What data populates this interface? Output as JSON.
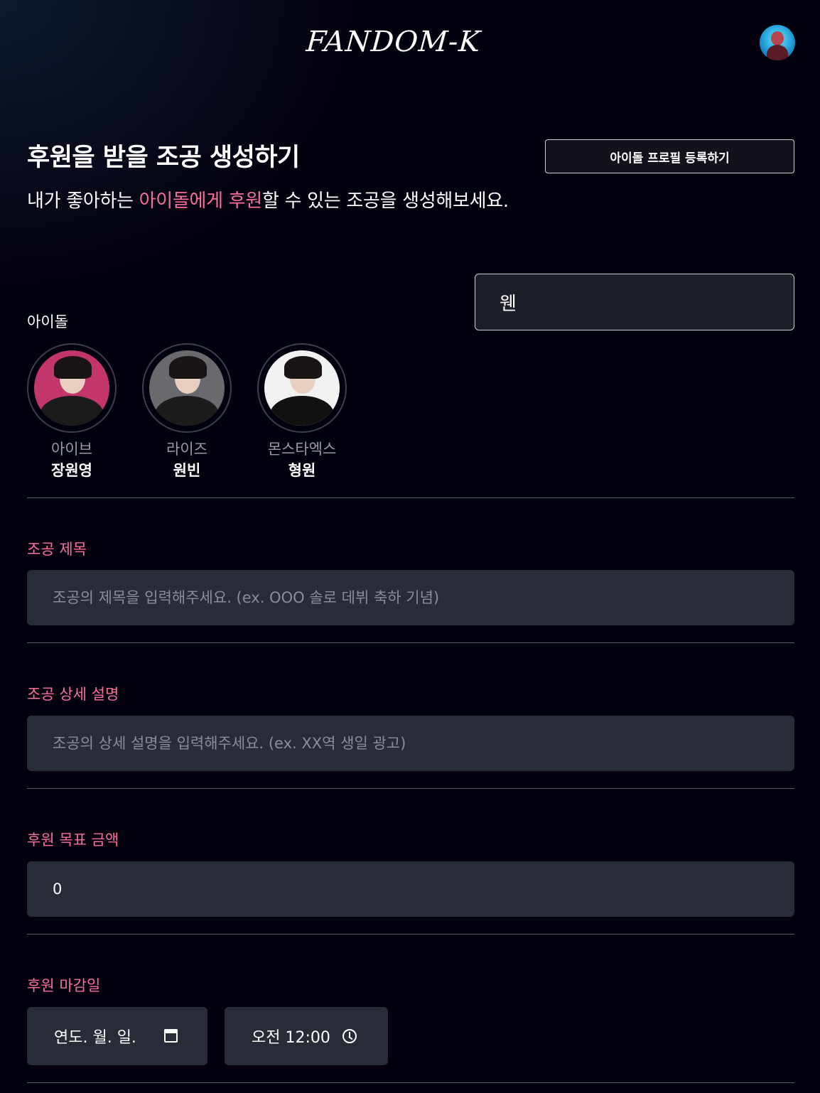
{
  "header": {
    "logo": "FANDOM-K",
    "avatar_icon": "user-avatar-icon"
  },
  "page": {
    "title": "후원을 받을 조공 생성하기",
    "register_button": "아이돌 프로필 등록하기",
    "subtitle": {
      "prefix": "내가 좋아하는 ",
      "highlight1": "아이돌에게",
      "middle": " ",
      "highlight2": "후원",
      "suffix": "할 수 있는 조공을 생성해보세요."
    }
  },
  "search": {
    "value": "웬"
  },
  "idols": {
    "label": "아이돌",
    "items": [
      {
        "group": "아이브",
        "name": "장원영",
        "bg": "#c2366b",
        "outfit": "#1b1b1b"
      },
      {
        "group": "라이즈",
        "name": "원빈",
        "bg": "#6a6a6e",
        "outfit": "#1c1c1c"
      },
      {
        "group": "몬스타엑스",
        "name": "형원",
        "bg": "#f2f2f2",
        "outfit": "#111111"
      }
    ]
  },
  "form": {
    "title_label": "조공 제목",
    "title_placeholder": "조공의 제목을 입력해주세요. (ex. OOO 솔로 데뷔 축하 기념)",
    "desc_label": "조공 상세 설명",
    "desc_placeholder": "조공의 상세 설명을 입력해주세요. (ex. XX역 생일 광고)",
    "amount_label": "후원 목표 금액",
    "amount_value": "0",
    "deadline_label": "후원 마감일",
    "date_value": "연도. 월. 일.",
    "time_value": "오전 12:00"
  },
  "colors": {
    "accent": "#f86f9a",
    "background": "#02000e",
    "input_bg": "#272c38"
  }
}
